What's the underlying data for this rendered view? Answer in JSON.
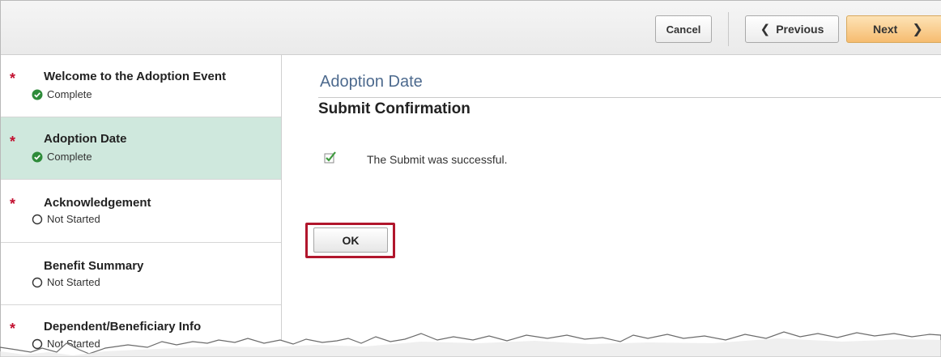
{
  "toolbar": {
    "cancel_label": "Cancel",
    "previous_label": "Previous",
    "next_label": "Next"
  },
  "sidebar": {
    "items": [
      {
        "title": "Welcome to the Adoption Event",
        "status": "Complete",
        "required": true,
        "selected": false
      },
      {
        "title": "Adoption Date",
        "status": "Complete",
        "required": true,
        "selected": true
      },
      {
        "title": "Acknowledgement",
        "status": "Not Started",
        "required": true,
        "selected": false
      },
      {
        "title": "Benefit Summary",
        "status": "Not Started",
        "required": false,
        "selected": false
      },
      {
        "title": "Dependent/Beneficiary Info",
        "status": "Not Started",
        "required": true,
        "selected": false
      }
    ],
    "required_marker": "*"
  },
  "main": {
    "page_heading": "Adoption Date",
    "subheading": "Submit Confirmation",
    "message": "The Submit was successful.",
    "ok_label": "OK"
  },
  "colors": {
    "selected_row": "#cfe8dd",
    "heading_blue": "#4d6a8e",
    "complete_green": "#2e8b3a",
    "required_red": "#c20f2f",
    "next_button": "#f6bc70",
    "highlight_border": "#b1162c"
  },
  "icons": {
    "complete": "check-circle-icon",
    "not_started": "empty-circle-icon",
    "success": "checkbox-check-icon",
    "previous": "chevron-left-icon",
    "next": "chevron-right-icon"
  }
}
